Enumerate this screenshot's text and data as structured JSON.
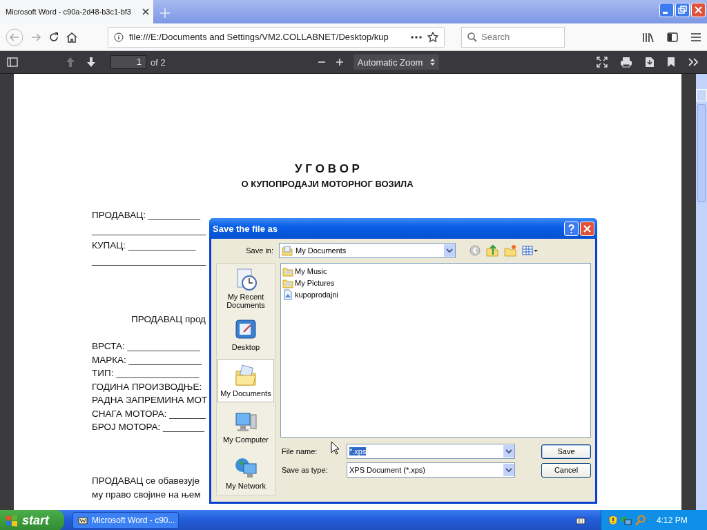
{
  "browser": {
    "tab": {
      "title": "Microsoft Word - c90a-2d48-b3c1-bf3"
    },
    "address": "file:///E:/Documents and Settings/VM2.COLLABNET/Desktop/kup",
    "search": {
      "placeholder": "Search"
    }
  },
  "pdf_toolbar": {
    "page": "1",
    "page_count": "of 2",
    "zoom": "Automatic Zoom"
  },
  "document": {
    "title": "У Г О В О Р",
    "subtitle": "О КУПОПРОДАЈИ МОТОРНОГ ВОЗИЛА",
    "blocks": [
      {
        "kind": "parties",
        "lines": [
          "ПРОДАВАЦ: __________",
          "______________________",
          "КУПАЦ: _____________",
          "______________________"
        ]
      },
      {
        "kind": "intro",
        "lines": [
          "ПРОДАВАЦ прод"
        ]
      },
      {
        "kind": "specs",
        "lines": [
          "ВРСТА: ______________",
          "МАРКА: ______________",
          "ТИП: ________________",
          "ГОДИНА ПРОИЗВОДЊЕ:",
          "РАДНА ЗАПРЕМИНА МОТ",
          "СНАГА МОТОРА: _______",
          "БРОЈ МОТОРА: ________"
        ]
      },
      {
        "kind": "obligation",
        "lines": [
          "ПРОДАВАЦ се обавезује",
          "му право својине на њем"
        ]
      }
    ]
  },
  "dialog": {
    "title": "Save the file as",
    "save_in": {
      "label": "Save in:",
      "value": "My Documents"
    },
    "places": [
      {
        "label": "My Recent Documents",
        "kind": "recent",
        "selected": false
      },
      {
        "label": "Desktop",
        "kind": "desktop",
        "selected": false
      },
      {
        "label": "My Documents",
        "kind": "documents",
        "selected": true
      },
      {
        "label": "My Computer",
        "kind": "computer",
        "selected": false
      },
      {
        "label": "My Network",
        "kind": "network",
        "selected": false
      }
    ],
    "files": [
      {
        "name": "My Music",
        "kind": "folder"
      },
      {
        "name": "My Pictures",
        "kind": "folder"
      },
      {
        "name": "kupoprodajni",
        "kind": "document"
      }
    ],
    "file_name": {
      "label": "File name:",
      "value": "*.xps"
    },
    "save_as_type": {
      "label": "Save as type:",
      "value": "XPS Document (*.xps)"
    },
    "buttons": [
      "Save",
      "Cancel"
    ]
  },
  "taskbar": {
    "start": "start",
    "tasks": [
      {
        "label": "Microsoft Word - c90...",
        "selected": false
      }
    ],
    "clock": "4:12 PM"
  }
}
